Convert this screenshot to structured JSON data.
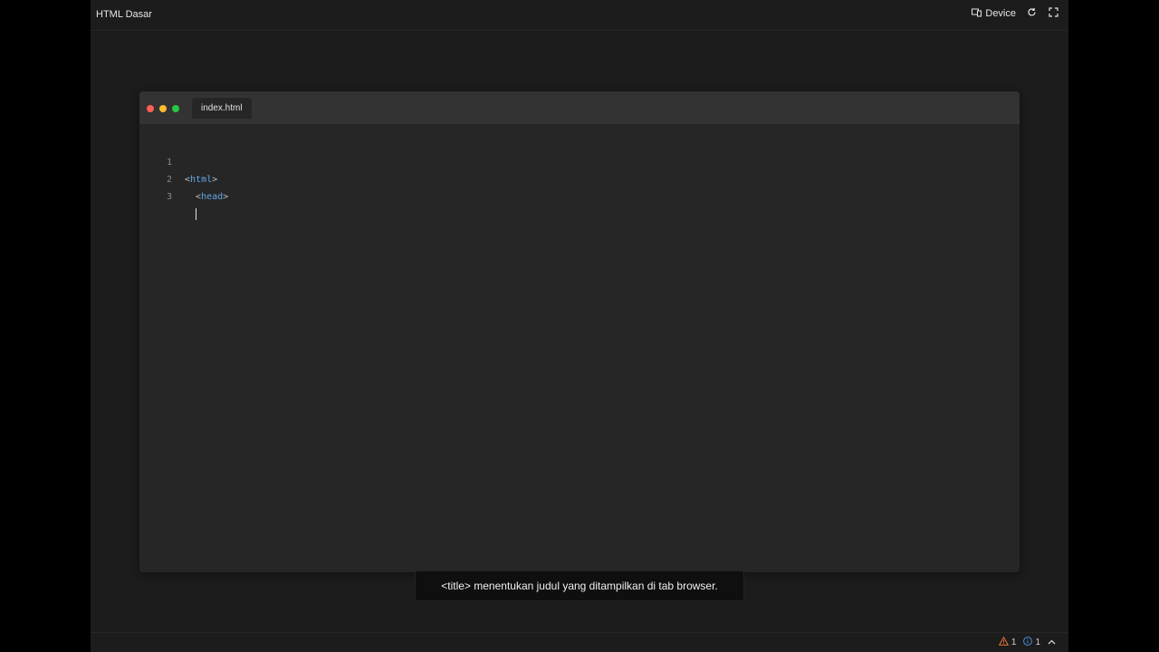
{
  "app": {
    "title": "HTML Dasar"
  },
  "toolbar": {
    "device_label": "Device"
  },
  "editor": {
    "tab_label": "index.html",
    "lines": [
      {
        "number": "1",
        "indent": "",
        "open": "<",
        "tag": "html",
        "close": ">"
      },
      {
        "number": "2",
        "indent": "  ",
        "open": "<",
        "tag": "head",
        "close": ">"
      },
      {
        "number": "3",
        "indent": "  ",
        "open": "",
        "tag": "",
        "close": ""
      }
    ]
  },
  "tooltip": {
    "text": "<title> menentukan judul yang ditampilkan di tab browser."
  },
  "status": {
    "warnings": "1",
    "info": "1"
  },
  "colors": {
    "tag": "#5fa8e8",
    "close_dot": "#ff5f57",
    "minimize_dot": "#febc2e",
    "zoom_dot": "#28c840",
    "warning": "#e8743b",
    "info": "#4a8fe0"
  },
  "icons": [
    "device-icon",
    "refresh-icon",
    "fullscreen-icon",
    "warning-icon",
    "info-icon",
    "chevron-up-icon"
  ]
}
